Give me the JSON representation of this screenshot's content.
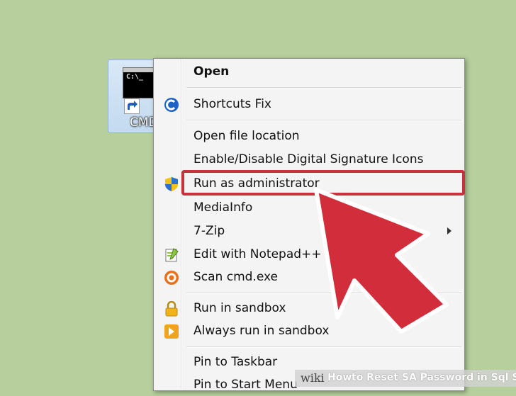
{
  "desktop": {
    "icon_label": "CMD",
    "cmd_prompt": "C:\\_"
  },
  "context_menu": {
    "items": [
      {
        "label": "Open",
        "bold": true
      },
      {
        "label": "Shortcuts Fix",
        "icon": "shortcuts-fix-icon"
      },
      {
        "label": "Open file location"
      },
      {
        "label": "Enable/Disable Digital Signature Icons"
      },
      {
        "label": "Run as administrator",
        "icon": "uac-shield-icon",
        "highlighted": true
      },
      {
        "label": "MediaInfo"
      },
      {
        "label": "7-Zip",
        "submenu": true
      },
      {
        "label": "Edit with Notepad++",
        "icon": "notepad-plus-plus-icon"
      },
      {
        "label": "Scan cmd.exe",
        "icon": "antivirus-icon"
      },
      {
        "label": "Run in sandbox",
        "icon": "sandbox-lock-icon"
      },
      {
        "label": "Always run in sandbox",
        "icon": "sandbox-arrow-icon"
      },
      {
        "label": "Pin to Taskbar"
      },
      {
        "label": "Pin to Start Menu"
      }
    ]
  },
  "annotation": {
    "highlight_color": "#c8313e"
  },
  "watermark": {
    "brand": "wiki",
    "how": "How",
    "title": "to Reset SA Password in Sql Server"
  }
}
